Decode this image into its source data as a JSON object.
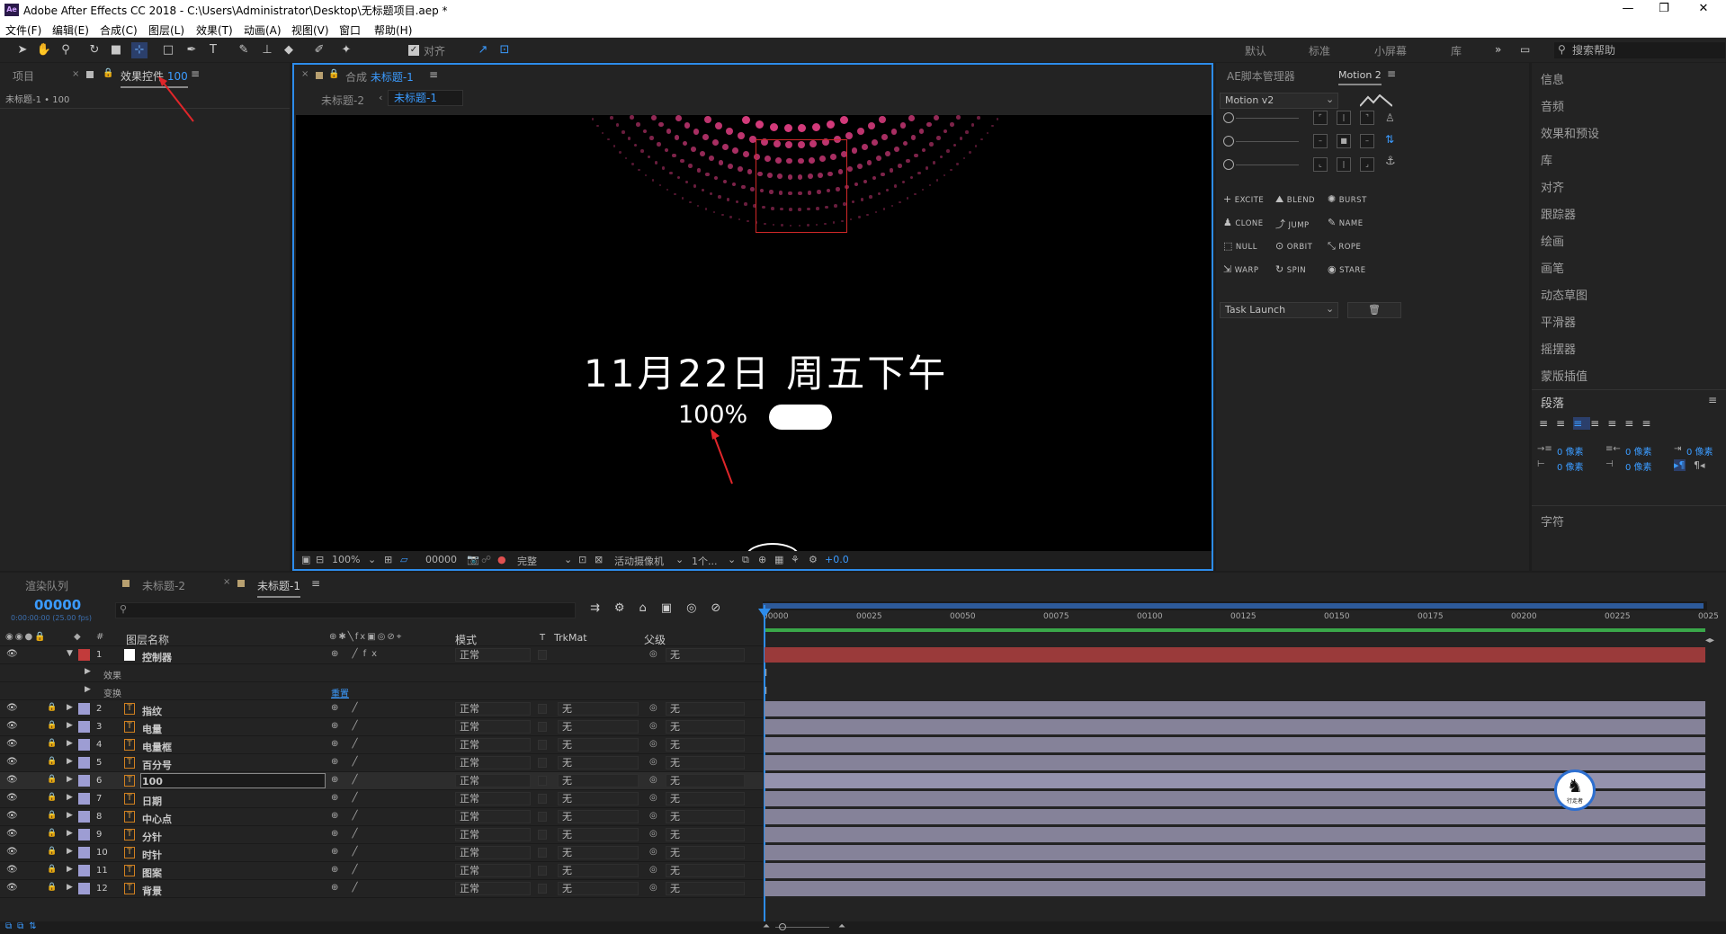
{
  "window": {
    "title": "Adobe After Effects CC 2018 - C:\\Users\\Administrator\\Desktop\\无标题项目.aep *",
    "app_icon": "Ae"
  },
  "menu": [
    "文件(F)",
    "编辑(E)",
    "合成(C)",
    "图层(L)",
    "效果(T)",
    "动画(A)",
    "视图(V)",
    "窗口",
    "帮助(H)"
  ],
  "toolbar": {
    "snap_label": "对齐",
    "workspaces": [
      "默认",
      "标准",
      "小屏幕",
      "库"
    ],
    "search_placeholder": "搜索帮助"
  },
  "project_panel": {
    "tab_project": "项目",
    "tab_effects": "效果控件",
    "tab_effects_suffix": "100",
    "subtitle": "未标题-1 • 100"
  },
  "comp_panel": {
    "tab_prefix": "合成",
    "tab_name": "未标题-1",
    "breadcrumb_prev": "未标题-2",
    "breadcrumb_current": "未标题-1",
    "date_text": "11月22日 周五下午",
    "percent_text": "100%",
    "zoom": "100%",
    "timecode": "00000",
    "resolution": "完整",
    "camera": "活动摄像机",
    "views": "1个...",
    "exposure": "+0.0"
  },
  "motion_panel": {
    "tab_scripts": "AE脚本管理器",
    "tab_motion": "Motion 2",
    "version_select": "Motion v2",
    "buttons": [
      {
        "label": "EXCITE",
        "icon": "plus-icon"
      },
      {
        "label": "BLEND",
        "icon": "blend-icon"
      },
      {
        "label": "BURST",
        "icon": "burst-icon"
      },
      {
        "label": "CLONE",
        "icon": "clone-icon"
      },
      {
        "label": "JUMP",
        "icon": "jump-icon"
      },
      {
        "label": "NAME",
        "icon": "pencil-icon"
      },
      {
        "label": "NULL",
        "icon": "null-icon"
      },
      {
        "label": "ORBIT",
        "icon": "orbit-icon"
      },
      {
        "label": "ROPE",
        "icon": "rope-icon"
      },
      {
        "label": "WARP",
        "icon": "warp-icon"
      },
      {
        "label": "SPIN",
        "icon": "spin-icon"
      },
      {
        "label": "STARE",
        "icon": "eye-icon"
      }
    ],
    "task_select": "Task Launch"
  },
  "side_panels": [
    "信息",
    "音频",
    "效果和预设",
    "库",
    "对齐",
    "跟踪器",
    "绘画",
    "画笔",
    "动态草图",
    "平滑器",
    "摇摆器",
    "蒙版插值"
  ],
  "paragraph_panel": {
    "title": "段落",
    "indent_values": [
      "0 像素",
      "0 像素",
      "0 像素",
      "0 像素",
      "0 像素"
    ],
    "char_title": "字符"
  },
  "timeline": {
    "tab_render": "渲染队列",
    "tab_comp2": "未标题-2",
    "tab_comp1": "未标题-1",
    "timecode": "00000",
    "fps": "0:00:00:00 (25.00 fps)",
    "col_layer_name": "图层名称",
    "col_mode": "模式",
    "col_t": "T",
    "col_trkmat": "TrkMat",
    "col_parent": "父级",
    "ruler": [
      "00000",
      "00025",
      "00050",
      "00075",
      "00100",
      "00125",
      "00150",
      "00175",
      "00200",
      "00225",
      "0025"
    ],
    "sub_effects": "效果",
    "sub_transform": "变换",
    "sub_reset": "重置",
    "layers": [
      {
        "num": "1",
        "name": "控制器",
        "mode": "正常",
        "trk": "",
        "parent": "无",
        "color": "#c23b3b",
        "solid": true
      },
      {
        "num": "2",
        "name": "指纹",
        "mode": "正常",
        "trk": "无",
        "parent": "无",
        "color": "#9d9dd3"
      },
      {
        "num": "3",
        "name": "电量",
        "mode": "正常",
        "trk": "无",
        "parent": "无",
        "color": "#9d9dd3"
      },
      {
        "num": "4",
        "name": "电量框",
        "mode": "正常",
        "trk": "无",
        "parent": "无",
        "color": "#9d9dd3"
      },
      {
        "num": "5",
        "name": "百分号",
        "mode": "正常",
        "trk": "无",
        "parent": "无",
        "color": "#9d9dd3"
      },
      {
        "num": "6",
        "name": "100",
        "mode": "正常",
        "trk": "无",
        "parent": "无",
        "color": "#9d9dd3",
        "selected": true
      },
      {
        "num": "7",
        "name": "日期",
        "mode": "正常",
        "trk": "无",
        "parent": "无",
        "color": "#9d9dd3"
      },
      {
        "num": "8",
        "name": "中心点",
        "mode": "正常",
        "trk": "无",
        "parent": "无",
        "color": "#9d9dd3"
      },
      {
        "num": "9",
        "name": "分针",
        "mode": "正常",
        "trk": "无",
        "parent": "无",
        "color": "#9d9dd3"
      },
      {
        "num": "10",
        "name": "时针",
        "mode": "正常",
        "trk": "无",
        "parent": "无",
        "color": "#9d9dd3"
      },
      {
        "num": "11",
        "name": "图案",
        "mode": "正常",
        "trk": "无",
        "parent": "无",
        "color": "#9d9dd3"
      },
      {
        "num": "12",
        "name": "背景",
        "mode": "正常",
        "trk": "无",
        "parent": "无",
        "color": "#9d9dd3"
      }
    ],
    "watermark": "行走者"
  },
  "colors": {
    "accent": "#2d8ceb",
    "control_bar": "#9a3a3a",
    "layer_bar": "#858299",
    "work_area": "#3aa84a",
    "dots": "#d23a7a"
  }
}
